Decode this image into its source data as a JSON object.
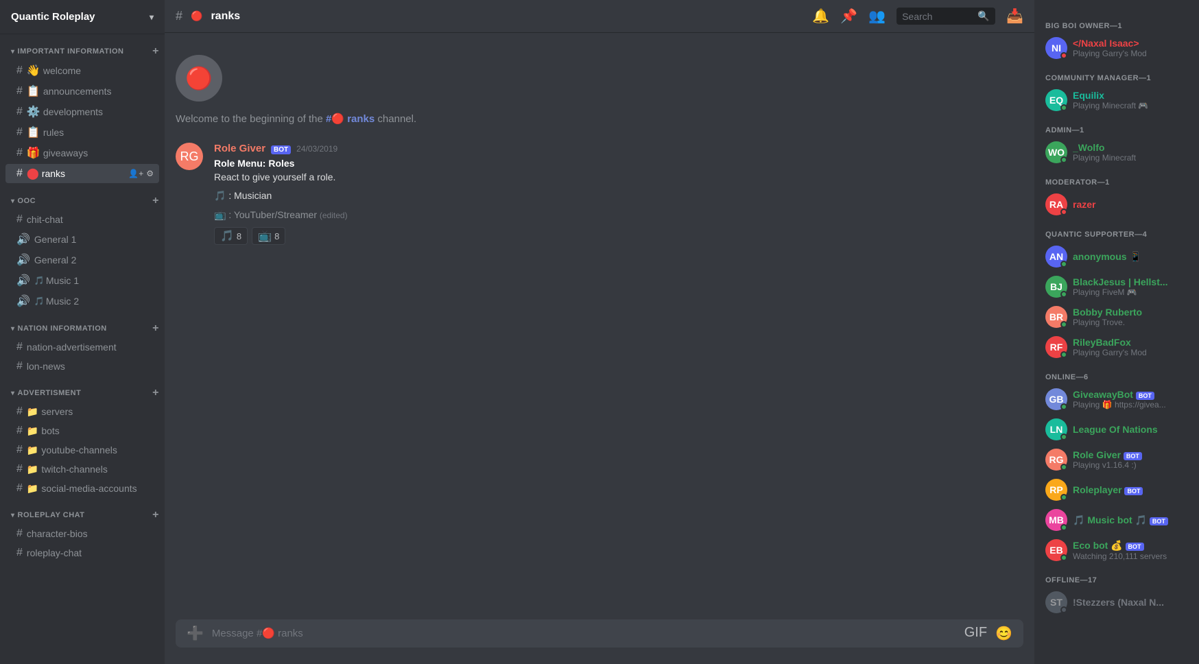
{
  "server": {
    "name": "Quantic Roleplay",
    "chevron": "▾"
  },
  "header": {
    "channel_icon": "#",
    "channel_dot": "🔴",
    "channel_name": "ranks",
    "search_placeholder": "Search",
    "icons": {
      "bell": "🔔",
      "pin": "📌",
      "members": "👥"
    }
  },
  "channel_start": {
    "text_prefix": "Welcome to the beginning of the ",
    "channel_mention": "#🔴 ranks",
    "text_suffix": " channel."
  },
  "messages": [
    {
      "id": "msg1",
      "author": "Role Giver",
      "is_bot": true,
      "bot_label": "BOT",
      "timestamp": "24/03/2019",
      "avatar_color": "#f47b67",
      "avatar_text": "RG",
      "lines": [
        "Role Menu: Roles",
        "React to give yourself a role.",
        "",
        "🎵 : Musician",
        "",
        "📺 : YouTuber/Streamer"
      ],
      "edited": "(edited)",
      "reactions": [
        {
          "emoji": "🎵",
          "count": "8"
        },
        {
          "emoji": "📺",
          "count": "8"
        }
      ]
    }
  ],
  "message_input": {
    "placeholder": "Message #🔴 ranks"
  },
  "sidebar": {
    "important_info": {
      "label": "IMPORTANT INFORMATION",
      "channels": [
        {
          "name": "welcome",
          "icon": "#",
          "prefix": "👋",
          "active": false
        },
        {
          "name": "announcements",
          "icon": "#",
          "prefix": "📋",
          "active": false
        },
        {
          "name": "developments",
          "icon": "#",
          "prefix": "⚙️",
          "active": false
        },
        {
          "name": "rules",
          "icon": "#",
          "prefix": "📋",
          "active": false
        },
        {
          "name": "giveaways",
          "icon": "#",
          "prefix": "🎁",
          "active": false
        },
        {
          "name": "ranks",
          "icon": "#",
          "prefix": "🔴",
          "active": true
        }
      ]
    },
    "ooc": {
      "label": "OOC",
      "channels": [
        {
          "name": "chit-chat",
          "icon": "#",
          "active": false
        },
        {
          "name": "General 1",
          "icon": "🔊",
          "active": false
        },
        {
          "name": "General 2",
          "icon": "🔊",
          "active": false
        },
        {
          "name": "Music 1",
          "icon": "🔊",
          "prefix": "🎵",
          "active": false
        },
        {
          "name": "Music 2",
          "icon": "🔊",
          "prefix": "🎵",
          "active": false
        }
      ]
    },
    "nation_info": {
      "label": "NATION INFORMATION",
      "channels": [
        {
          "name": "nation-advertisement",
          "icon": "#",
          "active": false
        },
        {
          "name": "lon-news",
          "icon": "#",
          "active": false
        }
      ]
    },
    "advertisment": {
      "label": "ADVERTISMENT",
      "channels": [
        {
          "name": "servers",
          "icon": "#",
          "folder": "📁",
          "active": false
        },
        {
          "name": "bots",
          "icon": "#",
          "folder": "📁",
          "active": false
        },
        {
          "name": "youtube-channels",
          "icon": "#",
          "folder": "📁",
          "active": false
        },
        {
          "name": "twitch-channels",
          "icon": "#",
          "folder": "📁",
          "active": false
        },
        {
          "name": "social-media-accounts",
          "icon": "#",
          "folder": "📁",
          "active": false
        }
      ]
    },
    "roleplay_chat": {
      "label": "ROLEPLAY CHAT",
      "channels": [
        {
          "name": "character-bios",
          "icon": "#",
          "active": false
        },
        {
          "name": "roleplay-chat",
          "icon": "#",
          "active": false
        }
      ]
    }
  },
  "members": {
    "big_boi_owner": {
      "label": "BIG BOI OWNER—1",
      "members": [
        {
          "name": "</Naxal Isaac>",
          "sub": "Playing Garry's Mod",
          "color": "#ed4245",
          "status": "dnd",
          "avatar_color": "#5865f2",
          "avatar_text": "NI"
        }
      ]
    },
    "community_manager": {
      "label": "COMMUNITY MANAGER—1",
      "members": [
        {
          "name": "Equilix",
          "sub": "Playing Minecraft 🎮",
          "color": "#1abc9c",
          "status": "online",
          "avatar_color": "#1abc9c",
          "avatar_text": "EQ"
        }
      ]
    },
    "admin": {
      "label": "ADMIN—1",
      "members": [
        {
          "name": "_Wolfo",
          "sub": "Playing Minecraft",
          "color": "#3ba55c",
          "status": "online",
          "avatar_color": "#3ba55c",
          "avatar_text": "WO"
        }
      ]
    },
    "moderator": {
      "label": "MODERATOR—1",
      "members": [
        {
          "name": "razer",
          "sub": "",
          "color": "#ed4245",
          "status": "dnd",
          "avatar_color": "#ed4245",
          "avatar_text": "RA"
        }
      ]
    },
    "quantic_supporter": {
      "label": "QUANTIC SUPPORTER—4",
      "members": [
        {
          "name": "anonymous",
          "sub": "📱",
          "color": "#3ba55c",
          "status": "online",
          "avatar_color": "#5865f2",
          "avatar_text": "AN"
        },
        {
          "name": "BlackJesus | Hellst...",
          "sub": "Playing FiveM 🎮",
          "color": "#3ba55c",
          "status": "online",
          "avatar_color": "#3ba55c",
          "avatar_text": "BJ"
        },
        {
          "name": "Bobby Ruberto",
          "sub": "Playing Trove.",
          "color": "#3ba55c",
          "status": "online",
          "avatar_color": "#f47b67",
          "avatar_text": "BR"
        },
        {
          "name": "RileyBadFox",
          "sub": "Playing Garry's Mod",
          "color": "#3ba55c",
          "status": "online",
          "avatar_color": "#ed4245",
          "avatar_text": "RF"
        }
      ]
    },
    "online": {
      "label": "ONLINE—6",
      "members": [
        {
          "name": "GiveawayBot",
          "sub": "Playing 🎁 https://givea...",
          "color": "#3ba55c",
          "status": "online",
          "avatar_color": "#7289da",
          "avatar_text": "GB",
          "is_bot": true
        },
        {
          "name": "League Of Nations",
          "sub": "",
          "color": "#3ba55c",
          "status": "online",
          "avatar_color": "#1abc9c",
          "avatar_text": "LN"
        },
        {
          "name": "Role Giver",
          "sub": "Playing v1.16.4 :)",
          "color": "#3ba55c",
          "status": "online",
          "avatar_color": "#f47b67",
          "avatar_text": "RG",
          "is_bot": true
        },
        {
          "name": "Roleplayer",
          "sub": "",
          "color": "#3ba55c",
          "status": "online",
          "avatar_color": "#faa81a",
          "avatar_text": "RP",
          "is_bot": true
        },
        {
          "name": "Music bot",
          "sub": "",
          "color": "#3ba55c",
          "status": "online",
          "avatar_color": "#eb459e",
          "avatar_text": "MB",
          "is_bot": true
        },
        {
          "name": "Eco bot 💰",
          "sub": "Watching 210,111 servers",
          "color": "#3ba55c",
          "status": "online",
          "avatar_color": "#ed4245",
          "avatar_text": "EB",
          "is_bot": true
        }
      ]
    },
    "offline": {
      "label": "OFFLINE—17",
      "members": [
        {
          "name": "!Stezzers (Naxal N...",
          "sub": "",
          "color": "#72767d",
          "status": "offline",
          "avatar_color": "#747f8d",
          "avatar_text": "ST"
        }
      ]
    }
  }
}
